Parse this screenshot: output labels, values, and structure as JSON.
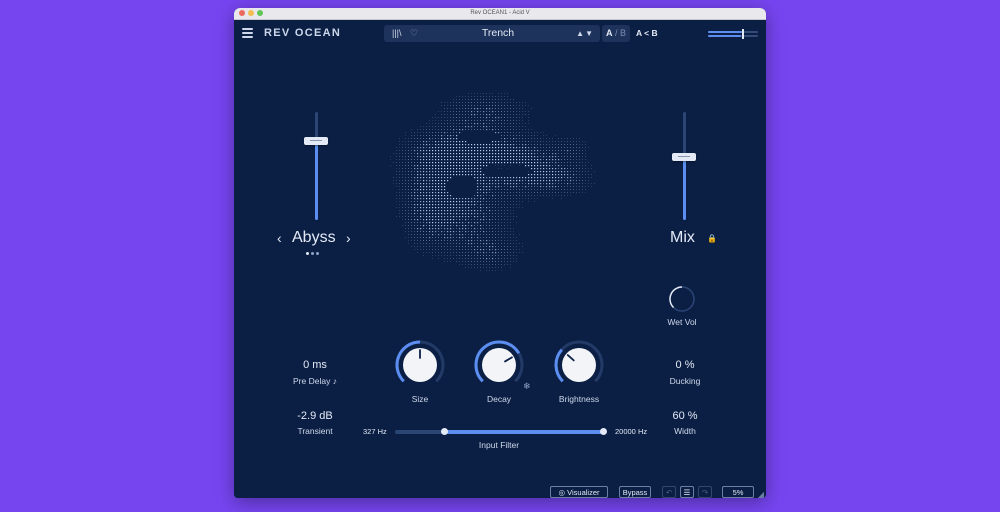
{
  "window": {
    "title": "Rev OCEAN1 - Acid V"
  },
  "header": {
    "brand": "REV OCEAN",
    "preset_name": "Trench",
    "ab_a": "A",
    "ab_sep": " / ",
    "ab_b": "B",
    "compare_label": "A < B"
  },
  "icons": {
    "menu": "hamburger-icon",
    "library": "library-icon",
    "favorite": "heart-icon",
    "preset_nav": "up-down-arrows-icon",
    "lock": "lock-icon",
    "tempo_sync": "note-icon",
    "freeze": "snowflake-icon",
    "visibility": "eye-off-icon",
    "undo": "undo-icon",
    "history": "list-icon",
    "redo": "redo-icon",
    "resize": "resize-grip-icon"
  },
  "mode": {
    "label": "Abyss",
    "prev": "‹",
    "next": "›",
    "page_count": 3,
    "current_page": 1
  },
  "mix": {
    "label": "Mix",
    "lock": "🔒"
  },
  "left_slider": {
    "level": 0.73
  },
  "mix_slider": {
    "level": 0.58
  },
  "wet_vol": {
    "label": "Wet Vol",
    "level": 0.5
  },
  "pre_delay": {
    "value": "0 ms",
    "label": "Pre Delay",
    "sync_icon": "♪"
  },
  "ducking": {
    "value": "0 %",
    "label": "Ducking"
  },
  "transient": {
    "value": "-2.9 dB",
    "label": "Transient"
  },
  "width": {
    "value": "60 %",
    "label": "Width"
  },
  "knobs": [
    {
      "label": "Size",
      "level": 0.5
    },
    {
      "label": "Decay",
      "level": 0.72
    },
    {
      "label": "Brightness",
      "level": 0.32
    }
  ],
  "freeze_icon": "❄",
  "input_filter": {
    "label": "Input Filter",
    "low_label": "327 Hz",
    "high_label": "20000 Hz",
    "low_pos": 0.24,
    "high_pos": 1.0
  },
  "footer": {
    "visualizer_label": "Visualizer",
    "bypass_label": "Bypass",
    "zoom_label": "5%",
    "undo_glyph": "↶",
    "history_glyph": "☰",
    "redo_glyph": "↷",
    "eye_glyph": "◎",
    "resize_glyph": "◢"
  },
  "colors": {
    "background": "#7645f0",
    "panel": "#0b1f45",
    "accent": "#5b8ef0",
    "text": "#e4eaf5",
    "track": "#2b4675"
  }
}
